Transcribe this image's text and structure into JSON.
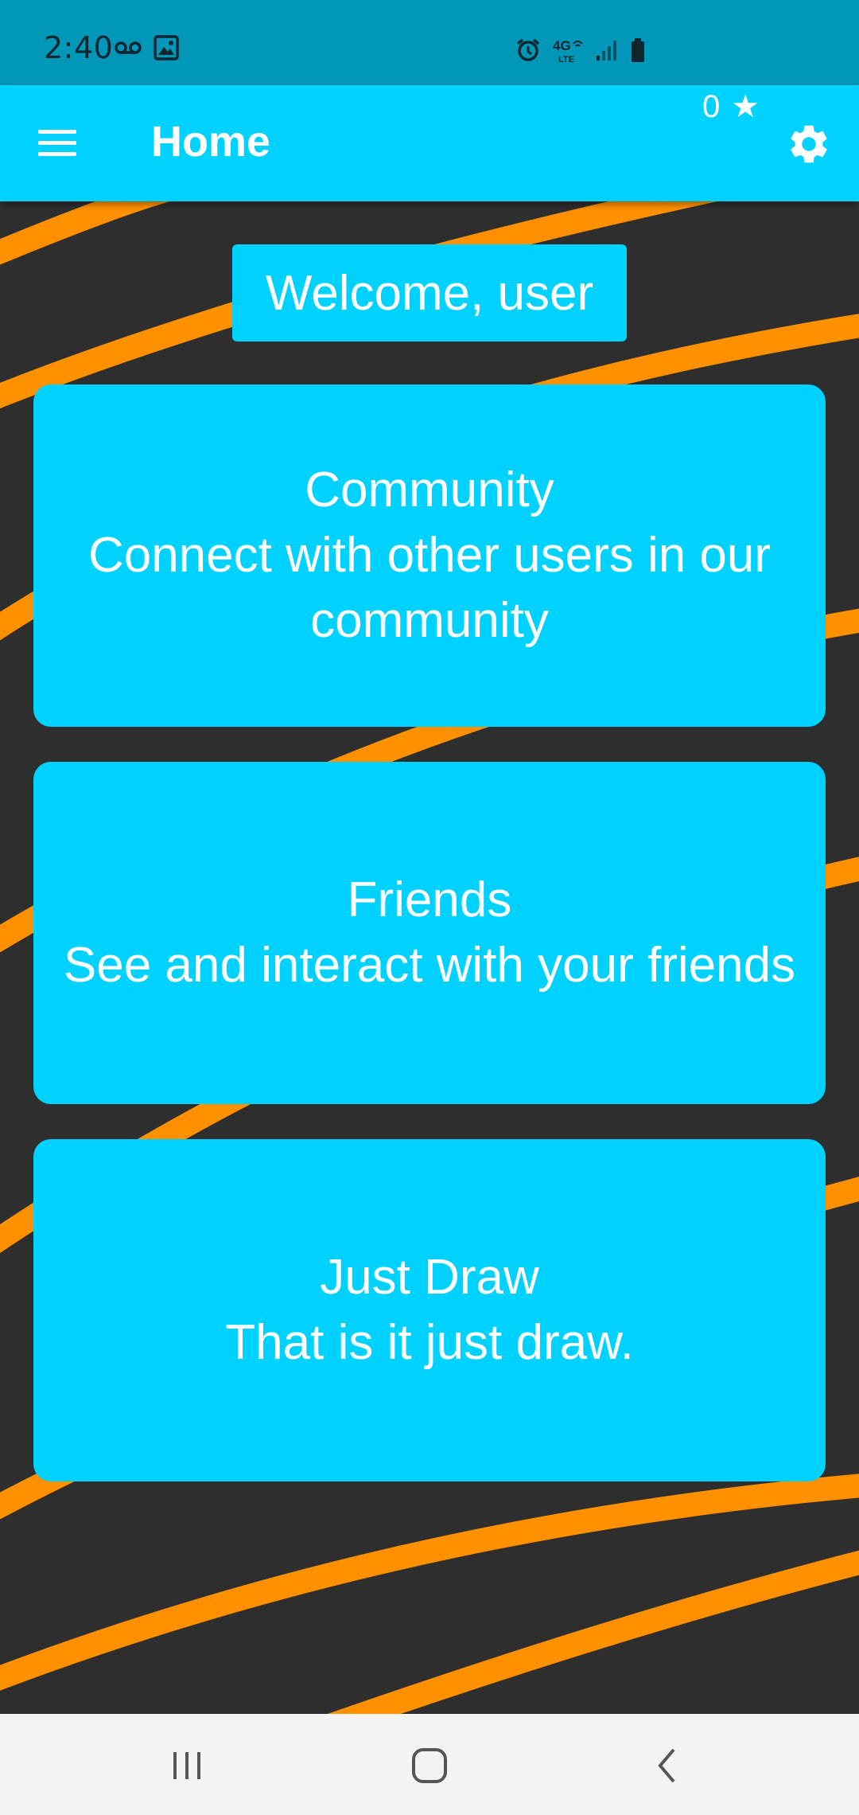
{
  "status_bar": {
    "time": "2:40",
    "left_icons": [
      "voicemail-icon",
      "image-icon"
    ],
    "right_icons": [
      "alarm-icon",
      "4g-lte-icon",
      "signal-icon",
      "battery-icon"
    ],
    "network": "4G LTE"
  },
  "app_bar": {
    "title": "Home",
    "star_count": "0",
    "star_symbol": "★",
    "menu_icon": "hamburger-menu-icon",
    "settings_icon": "gear-icon"
  },
  "welcome": {
    "text": "Welcome, user"
  },
  "cards": [
    {
      "title": "Community",
      "description": "Connect with other users in our community"
    },
    {
      "title": "Friends",
      "description": "See and interact with your friends"
    },
    {
      "title": "Just Draw",
      "description": "That is it just draw."
    }
  ],
  "nav_bar": {
    "buttons": [
      "recent-apps-icon",
      "home-icon",
      "back-icon"
    ]
  },
  "colors": {
    "status_bar": "#0097b8",
    "accent": "#00d2ff",
    "background": "#2e2e2e",
    "stripe": "#ff9100",
    "nav_bar": "#f4f4f4"
  }
}
